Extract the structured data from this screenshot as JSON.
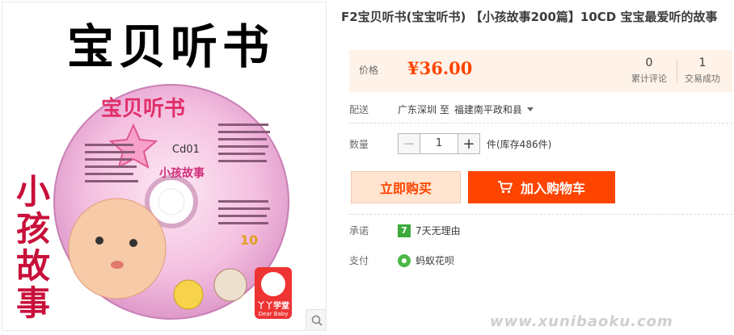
{
  "product_image": {
    "big_title": "宝贝听书",
    "side_text": "小孩故事",
    "disc_title": "宝贝听书",
    "disc_code": "Cd01",
    "disc_subtitle": "小孩故事",
    "disc_number": "10",
    "brand_logo_text": "丫丫学堂",
    "brand_logo_sub": "Dear Baby",
    "zoom_icon": "magnifier-icon"
  },
  "product": {
    "title": "F2宝贝听书(宝宝听书) 【小孩故事200篇】10CD 宝宝最爱听的故事"
  },
  "price_panel": {
    "price_label": "价格",
    "price": "¥36.00",
    "reviews_count": "0",
    "reviews_label": "累计评论",
    "sales_count": "1",
    "sales_label": "交易成功"
  },
  "shipping": {
    "label": "配送",
    "from": "广东深圳 至",
    "to": "福建南平政和县"
  },
  "quantity": {
    "label": "数量",
    "minus": "−",
    "value": "1",
    "plus": "+",
    "stock": "件(库存486件)"
  },
  "actions": {
    "buy_now": "立即购买",
    "add_to_cart": "加入购物车",
    "cart_icon": "cart-icon"
  },
  "promise": {
    "label": "承诺",
    "badge": "7",
    "text": "7天无理由"
  },
  "payment": {
    "label": "支付",
    "text": "蚂蚁花呗"
  },
  "watermark": "www.xunibaoku.com",
  "colors": {
    "accent": "#ff4400",
    "price_bg": "#fff2e8",
    "buy_bg": "#ffe4d0"
  }
}
